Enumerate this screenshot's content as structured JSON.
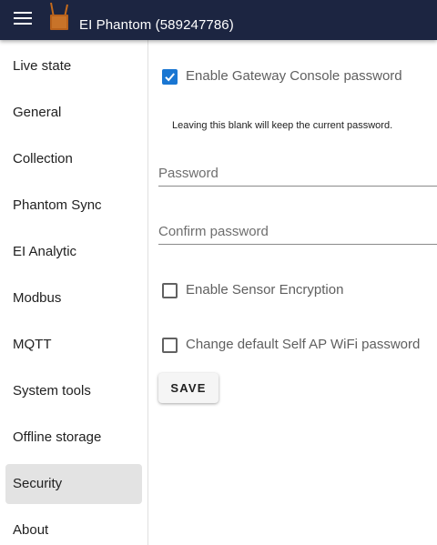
{
  "header": {
    "title": "EI Phantom (589247786)",
    "menu_icon": "hamburger-menu-icon",
    "logo_icon": "gateway-device-logo",
    "background": "#1c2541"
  },
  "sidebar": {
    "items": [
      {
        "label": "Live state",
        "active": false
      },
      {
        "label": "General",
        "active": false
      },
      {
        "label": "Collection",
        "active": false
      },
      {
        "label": "Phantom Sync",
        "active": false
      },
      {
        "label": "EI Analytic",
        "active": false
      },
      {
        "label": "Modbus",
        "active": false
      },
      {
        "label": "MQTT",
        "active": false
      },
      {
        "label": "System tools",
        "active": false
      },
      {
        "label": "Offline storage",
        "active": false
      },
      {
        "label": "Security",
        "active": true
      },
      {
        "label": "About",
        "active": false
      }
    ]
  },
  "security": {
    "console_password": {
      "label": "Enable Gateway Console password",
      "checked": true
    },
    "hint": "Leaving this blank will keep the current password.",
    "password": {
      "placeholder": "Password",
      "value": ""
    },
    "confirm_password": {
      "placeholder": "Confirm password",
      "value": ""
    },
    "sensor_encryption": {
      "label": "Enable Sensor Encryption",
      "checked": false
    },
    "self_ap_password": {
      "label": "Change default Self AP WiFi password",
      "checked": false
    },
    "save_label": "SAVE",
    "accent": "#1976d2"
  }
}
